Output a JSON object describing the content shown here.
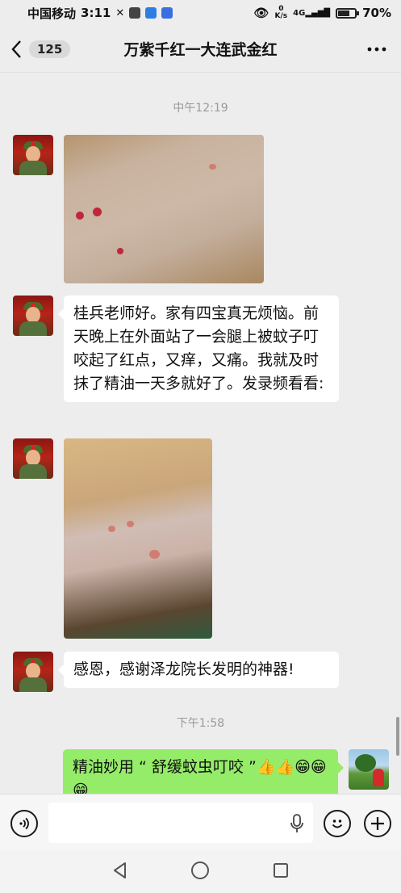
{
  "status_bar": {
    "carrier": "中国移动",
    "time": "3:11",
    "net_speed_value": "0",
    "net_speed_unit": "K/s",
    "network": "4G",
    "battery": "70%",
    "battery_level": 0.7
  },
  "header": {
    "unread_count": "125",
    "title": "万紫千红一大连武金红"
  },
  "messages": {
    "time1": "中午12:19",
    "m2_text": "桂兵老师好。家有四宝真无烦恼。前天晚上在外面站了一会腿上被蚊子叮咬起了红点，又痒，又痛。我就及时抹了精油一天多就好了。发录频看看:",
    "m4_text": "感恩，感谢泽龙院长发明的神器!",
    "time2": "下午1:58",
    "m5_text": "精油妙用 “ 舒缓蚊虫叮咬 ”👍👍😁😁😁"
  },
  "colors": {
    "background": "#ededed",
    "bubble_sent": "#95ec69",
    "bubble_received": "#ffffff",
    "timestamp": "#9a9a9a"
  },
  "icons": {
    "back": "chevron-left-icon",
    "more": "more-dots-icon",
    "voice": "voice-icon",
    "mic": "microphone-icon",
    "emoji": "emoji-icon",
    "add": "plus-icon",
    "nav_back": "triangle-back-icon",
    "nav_home": "circle-home-icon",
    "nav_recent": "square-recent-icon"
  }
}
